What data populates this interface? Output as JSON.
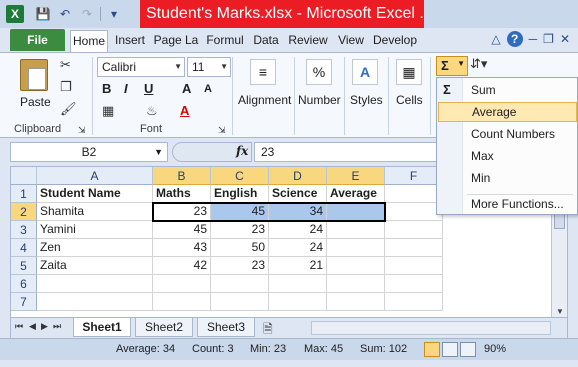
{
  "window": {
    "title": "Student's Marks.xlsx - Microsoft Excel ...",
    "app_icon": "X"
  },
  "quick_access": {
    "icons": [
      "save-icon",
      "undo-icon",
      "redo-icon",
      "customize-icon"
    ]
  },
  "tabs": {
    "file": "File",
    "items": [
      "Home",
      "Insert",
      "Page La",
      "Formul",
      "Data",
      "Review",
      "View",
      "Develop"
    ]
  },
  "ribbon": {
    "clipboard": {
      "paste": "Paste",
      "label": "Clipboard"
    },
    "font": {
      "name": "Calibri",
      "size": "11",
      "label": "Font",
      "bold": "B",
      "italic": "I",
      "underline": "U",
      "grow": "A",
      "shrink": "A"
    },
    "alignment": {
      "label": "Alignment"
    },
    "number": {
      "label": "Number",
      "icon_text": "%"
    },
    "styles": {
      "label": "Styles"
    },
    "cells": {
      "label": "Cells"
    }
  },
  "formula_bar": {
    "name_box": "B2",
    "fx": "fx",
    "value": "23"
  },
  "grid": {
    "columns": [
      "A",
      "B",
      "C",
      "D",
      "E",
      "F"
    ],
    "rows": [
      "1",
      "2",
      "3",
      "4",
      "5",
      "6",
      "7"
    ],
    "header_row": [
      "Student Name",
      "Maths",
      "English",
      "Science",
      "Average"
    ],
    "data": [
      [
        "Shamita",
        "23",
        "45",
        "34"
      ],
      [
        "Yamini",
        "45",
        "23",
        "24"
      ],
      [
        "Zen",
        "43",
        "50",
        "24"
      ],
      [
        "Zaita",
        "42",
        "23",
        "21"
      ]
    ]
  },
  "sheets": {
    "tabs": [
      "Sheet1",
      "Sheet2",
      "Sheet3"
    ],
    "active": "Sheet1"
  },
  "status": {
    "average": "Average: 34",
    "count": "Count: 3",
    "min": "Min: 23",
    "max": "Max: 45",
    "sum": "Sum: 102",
    "zoom": "90%"
  },
  "autosum_menu": {
    "button_symbol": "Σ",
    "items": [
      "Sum",
      "Average",
      "Count Numbers",
      "Max",
      "Min",
      "More Functions..."
    ],
    "hovered": "Average",
    "sum_icon": "Σ"
  },
  "colors": {
    "title_bar_highlight": "#ec1c24",
    "file_tab": "#3b8c3f",
    "selection_header": "#f9d77e",
    "selection_fill": "#a9c8ec",
    "menu_hover": "#fde9b1"
  }
}
